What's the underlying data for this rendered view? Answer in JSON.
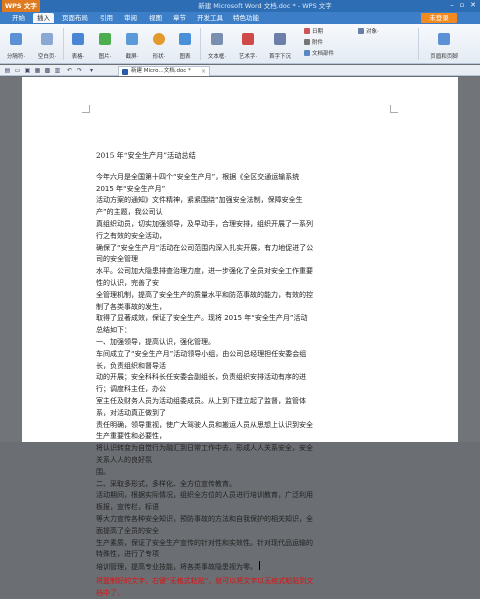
{
  "app": {
    "name": "WPS 文字",
    "window_title": "新建 Microsoft Word 文档.doc * - WPS 文字"
  },
  "menu": {
    "tabs": [
      "开始",
      "插入",
      "页面布局",
      "引用",
      "审阅",
      "视图",
      "章节",
      "开发工具",
      "特色功能"
    ],
    "active_index": 1,
    "login_label": "未登录"
  },
  "ribbon": {
    "items": [
      {
        "label": "分隔符·",
        "icon": "page-break-icon",
        "color": "#5b8fd6"
      },
      {
        "label": "空白页·",
        "icon": "blank-page-icon",
        "color": "#8aa8d4"
      },
      {
        "label": "表格·",
        "icon": "table-icon",
        "color": "#4a86d6"
      },
      {
        "label": "图片·",
        "icon": "image-icon",
        "color": "#4cae4f"
      },
      {
        "label": "截屏·",
        "icon": "screenshot-icon",
        "color": "#5a9ad8"
      },
      {
        "label": "形状·",
        "icon": "shapes-icon",
        "color": "#e39a2c"
      },
      {
        "label": "图表",
        "icon": "chart-icon",
        "color": "#4a90d9"
      },
      {
        "label": "文本框·",
        "icon": "textbox-icon",
        "color": "#7a8fb0"
      },
      {
        "label": "艺术字·",
        "icon": "wordart-icon",
        "color": "#d04a4a"
      },
      {
        "label": "首字下沉",
        "icon": "dropcap-icon",
        "color": "#6b7fa8"
      },
      {
        "label": "页眉和页脚",
        "icon": "header-footer-icon",
        "color": "#5b8fd6"
      }
    ],
    "small_items": [
      {
        "label": "日期",
        "icon": "calendar-icon",
        "color": "#c55"
      },
      {
        "label": "附件",
        "icon": "attachment-icon",
        "color": "#777"
      },
      {
        "label": "文档部件",
        "icon": "doc-parts-icon",
        "color": "#5a86c4"
      },
      {
        "label": "对象·",
        "icon": "object-icon",
        "color": "#6a7fa8"
      }
    ]
  },
  "doc_tab": {
    "label": "新建 Micro...文档.doc *"
  },
  "document": {
    "title": "2015 年“安全生产月”活动总结",
    "lines": [
      "今年六月是全国第十四个“安全生产月”，根据《全区交通运输系统 2015 年“安全生产月”",
      "活动方案的通知》文件精神，紧紧围绕“加强安全法制，保障安全生产”的主题，我公司认",
      "真组织动员，切实加强领导，及早动手，合理安排，组织开展了一系列行之有效的安全活动，",
      "确保了“安全生产月”活动在公司范围内深入扎实开展，有力地促进了公司的安全管理",
      "水平。公司加大隐患排查治理力度，进一步强化了全员对安全工作重要性的认识，完善了安",
      "全管理机制，提高了安全生产的质量水平和防范事故的能力，有效的控制了各类事故的发生，",
      "取得了显著成效，保证了安全生产。现将 2015 年“安全生产月”活动总结如下：",
      "一、加强领导，提高认识，强化管理。",
      "车间成立了“安全生产月”活动领导小组，由公司总经理担任安委会组长，负责组织和督导活",
      "动的开展；安全科科长任安委会副组长，负责组织安排活动有序的进行；调度科主任，办公",
      "室主任及财务人员为活动组委成员。从上到下建立起了监督，监管体系，对活动真正做到了",
      "责任明确，领导重视，使广大驾驶人员和搬运人员从思想上认识到安全生产重要性和必要性，",
      "将认识转变为自觉行为融汇到日常工作中去，形成人人关系安全，安全关系人人的良好氛",
      "围。",
      "二、采取多形式，多样化、全方位宣传教育。",
      "活动期间，根据实际情况，组织全方位的人员进行培训教育，广泛利用板报，宣传栏，标语",
      "等大力宣传各种安全知识，预防事故的方法和自我保护的相关知识，全面提高了全员的安全",
      "生产素质，保证了安全生产宣传的针对性和实效性。针对现代品运输的特殊性，进行了专项",
      "培训管理，提高专业技能，将各类事故隐患视为零。"
    ],
    "note": "将复制好的文字，右键“无格式粘贴”，就可以将文字以无格式粘贴到文档中了。"
  }
}
